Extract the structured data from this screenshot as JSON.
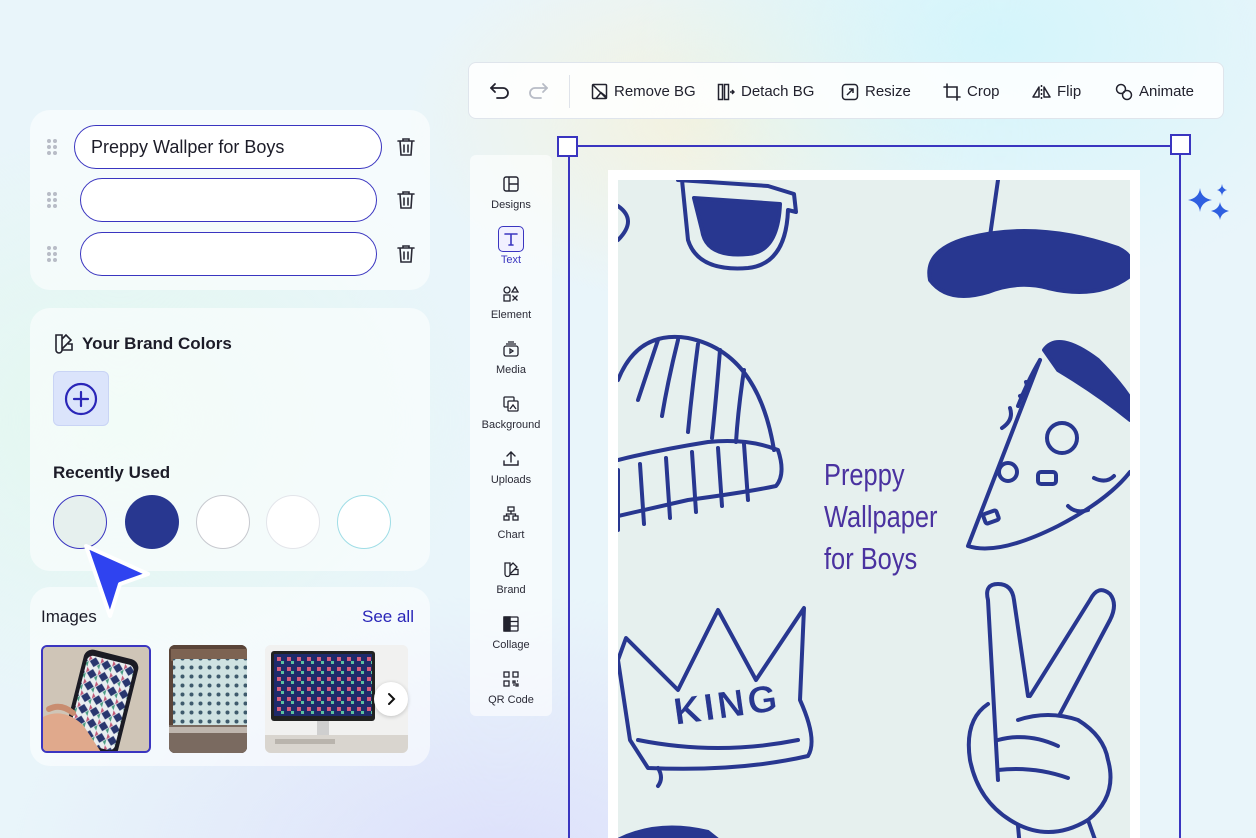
{
  "text_fields": {
    "items": [
      {
        "value": "Preppy Wallper for Boys"
      },
      {
        "value": ""
      },
      {
        "value": ""
      }
    ]
  },
  "brand_colors": {
    "title": "Your Brand Colors",
    "recent_title": "Recently Used",
    "recent": [
      "#e6f0ee",
      "#283790",
      "#ffffff",
      "#ffffff",
      "#ffffff"
    ]
  },
  "images": {
    "title": "Images",
    "see_all": "See all"
  },
  "toolbar": {
    "undo": "undo-icon",
    "redo": "redo-icon",
    "remove_bg": "Remove BG",
    "detach_bg": "Detach BG",
    "resize": "Resize",
    "crop": "Crop",
    "flip": "Flip",
    "animate": "Animate"
  },
  "sidebar": {
    "items": [
      {
        "label": "Designs"
      },
      {
        "label": "Text"
      },
      {
        "label": "Element"
      },
      {
        "label": "Media"
      },
      {
        "label": "Background"
      },
      {
        "label": "Uploads"
      },
      {
        "label": "Chart"
      },
      {
        "label": "Brand"
      },
      {
        "label": "Collage"
      },
      {
        "label": "QR Code"
      }
    ],
    "active": "Text"
  },
  "canvas": {
    "title_lines": [
      "Preppy",
      "Wallpaper",
      "for Boys"
    ],
    "crown_text": "KING",
    "background": "#e6f0ee",
    "ink": "#283790"
  },
  "colors": {
    "accent": "#3a35c0",
    "cursor": "#2f43f0"
  }
}
